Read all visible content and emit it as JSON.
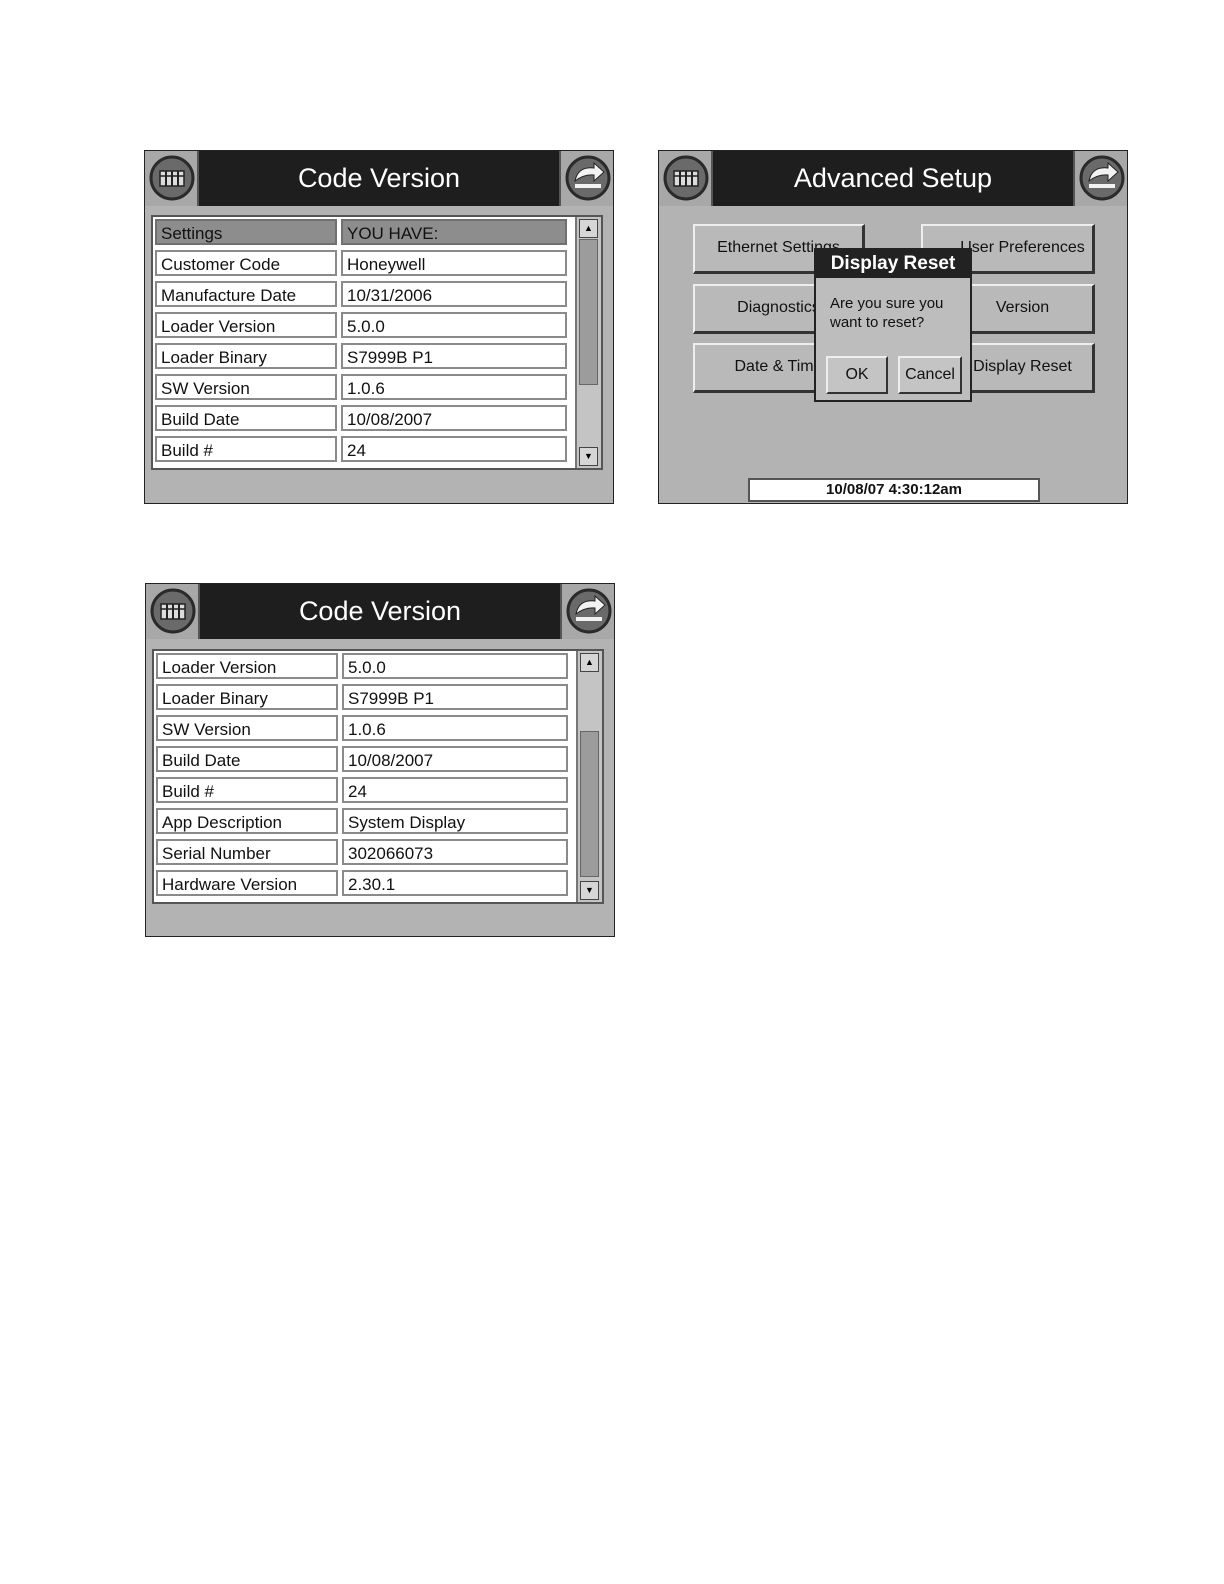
{
  "screen1": {
    "title": "Code Version",
    "header": [
      "Settings",
      "YOU HAVE:"
    ],
    "rows": [
      {
        "label": "Customer Code",
        "value": "Honeywell"
      },
      {
        "label": "Manufacture Date",
        "value": "10/31/2006"
      },
      {
        "label": "Loader Version",
        "value": "5.0.0"
      },
      {
        "label": "Loader Binary",
        "value": "S7999B P1"
      },
      {
        "label": "SW Version",
        "value": "1.0.6"
      },
      {
        "label": "Build Date",
        "value": "10/08/2007"
      },
      {
        "label": "Build #",
        "value": "24"
      }
    ]
  },
  "screen2": {
    "title": "Advanced Setup",
    "buttons": {
      "ethernet_settings": "Ethernet Settings",
      "user_preferences": "User Preferences",
      "diagnostics": "Diagnostics",
      "version": "Version",
      "date_time": "Date & Time",
      "display_reset": "Display Reset"
    },
    "dialog": {
      "title": "Display Reset",
      "message": "Are you sure you want to reset?",
      "ok": "OK",
      "cancel": "Cancel"
    },
    "clock": "10/08/07  4:30:12am"
  },
  "screen3": {
    "title": "Code Version",
    "rows": [
      {
        "label": "Loader Version",
        "value": "5.0.0"
      },
      {
        "label": "Loader Binary",
        "value": "S7999B P1"
      },
      {
        "label": "SW Version",
        "value": "1.0.6"
      },
      {
        "label": "Build Date",
        "value": "10/08/2007"
      },
      {
        "label": "Build #",
        "value": "24"
      },
      {
        "label": "App Description",
        "value": "System Display"
      },
      {
        "label": "Serial Number",
        "value": "302066073"
      },
      {
        "label": "Hardware Version",
        "value": "2.30.1"
      }
    ]
  },
  "icons": {
    "left": "home-icon",
    "right": "back-arrow-icon"
  }
}
